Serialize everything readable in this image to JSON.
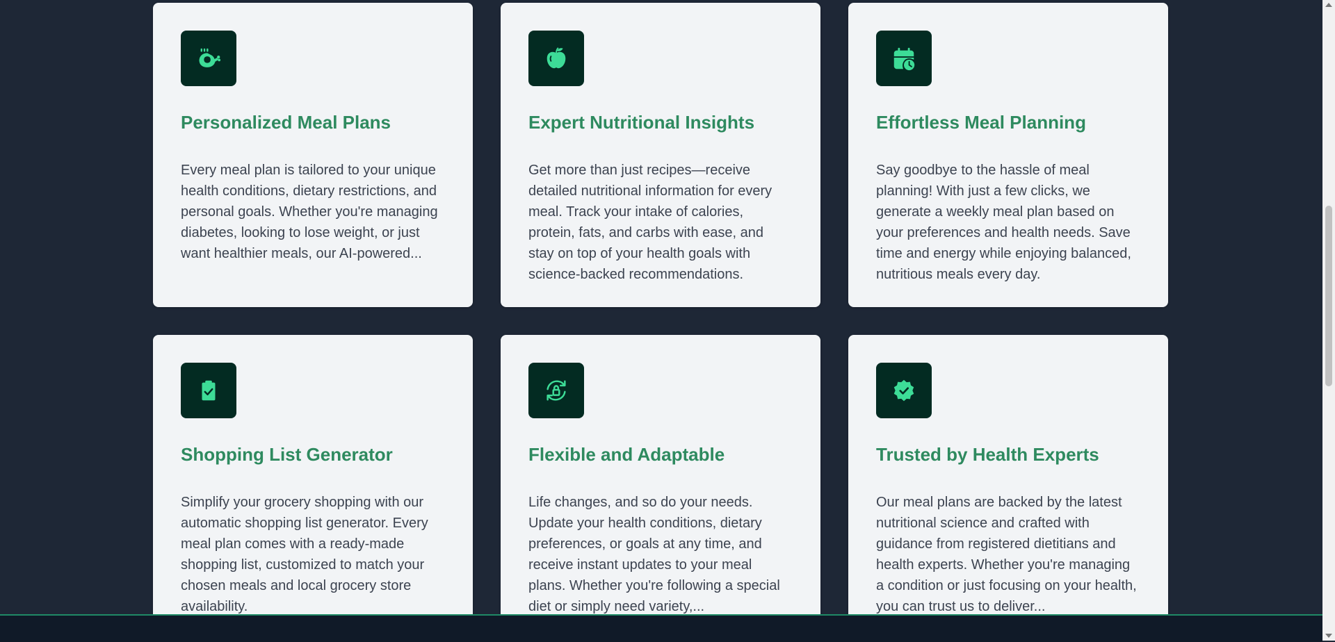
{
  "colors": {
    "background": "#1e2736",
    "card": "#f2f4f6",
    "icon_bg": "#032b22",
    "icon_fg": "#3ddc97",
    "title": "#2e8a5f",
    "text": "#3c4350"
  },
  "features": [
    {
      "icon": "chicken-drumstick-icon",
      "title": "Personalized Meal Plans",
      "description": "Every meal plan is tailored to your unique health conditions, dietary restrictions, and personal goals. Whether you're managing diabetes, looking to lose weight, or just want healthier meals, our AI-powered..."
    },
    {
      "icon": "apple-icon",
      "title": "Expert Nutritional Insights",
      "description": "Get more than just recipes—receive detailed nutritional information for every meal. Track your intake of calories, protein, fats, and carbs with ease, and stay on top of your health goals with science-backed recommendations."
    },
    {
      "icon": "calendar-clock-icon",
      "title": "Effortless Meal Planning",
      "description": "Say goodbye to the hassle of meal planning! With just a few clicks, we generate a weekly meal plan based on your preferences and health needs. Save time and energy while enjoying balanced, nutritious meals every day."
    },
    {
      "icon": "clipboard-check-icon",
      "title": "Shopping List Generator",
      "description": "Simplify your grocery shopping with our automatic shopping list generator. Every meal plan comes with a ready-made shopping list, customized to match your chosen meals and local grocery store availability."
    },
    {
      "icon": "refresh-lock-icon",
      "title": "Flexible and Adaptable",
      "description": "Life changes, and so do your needs. Update your health conditions, dietary preferences, or goals at any time, and receive instant updates to your meal plans. Whether you're following a special diet or simply need variety,..."
    },
    {
      "icon": "verified-badge-icon",
      "title": "Trusted by Health Experts",
      "description": "Our meal plans are backed by the latest nutritional science and crafted with guidance from registered dietitians and health experts. Whether you're managing a condition or just focusing on your health, you can trust us to deliver..."
    }
  ]
}
